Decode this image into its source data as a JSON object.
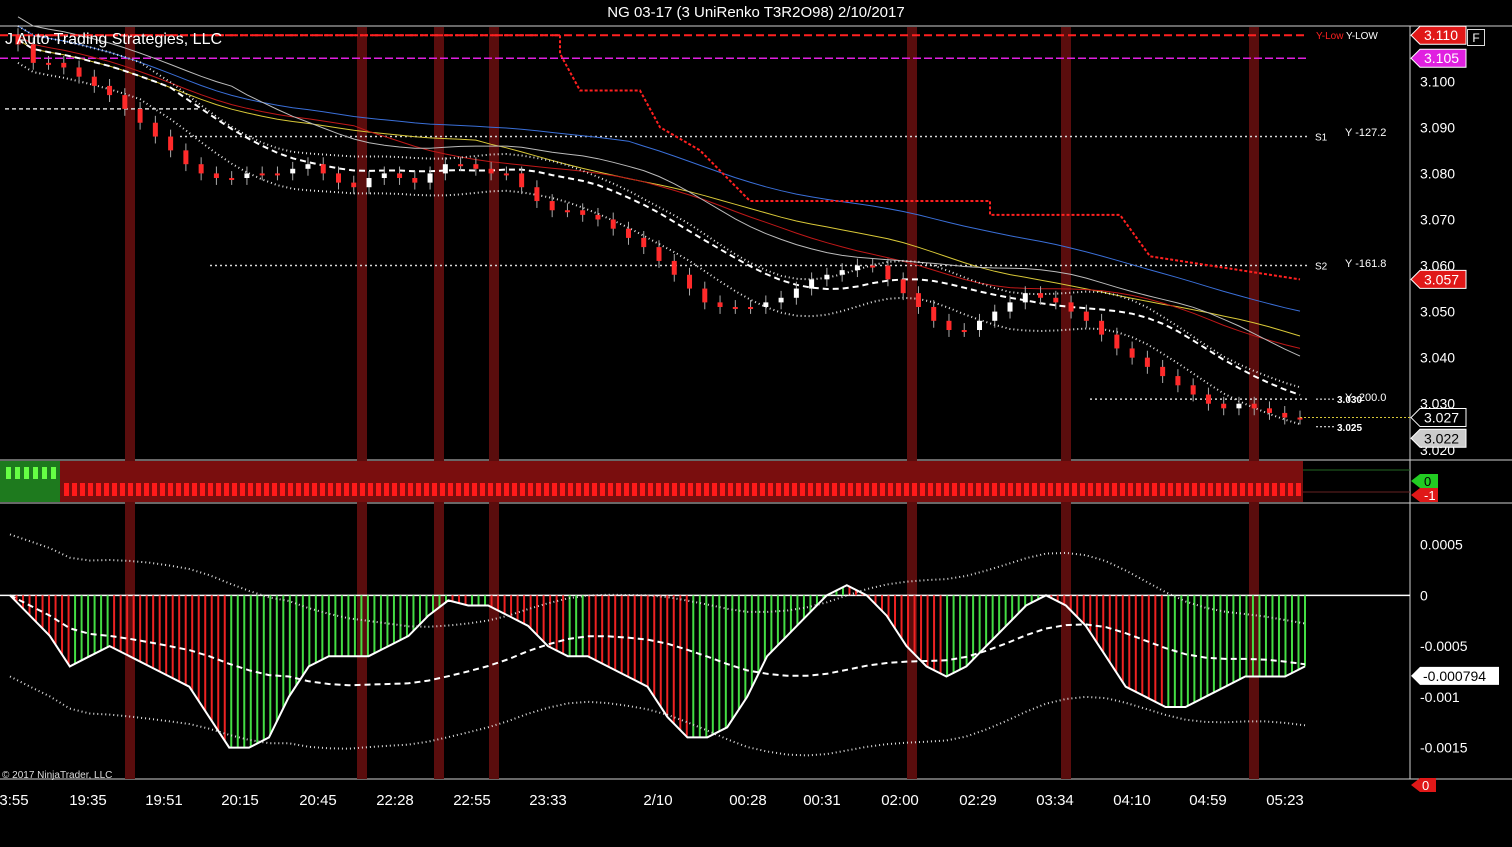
{
  "window": {
    "title": "NG 03-17 (3 UniRenko T3R2O98)  2/10/2017",
    "strategy_label": "J Auto Trading Strategies, LLC",
    "copyright": "© 2017 NinjaTrader, LLC",
    "f_button": "F"
  },
  "colors": {
    "background": "#000000",
    "bear_candle": "#ff2a2a",
    "bull_candle": "#ffffff",
    "session_band": "#5a0d0d",
    "pivot_red": "#ff2020",
    "magenta": "#e020e0",
    "blue_ma": "#3a6fd8",
    "yellow_ma": "#d8c838",
    "hist_green": "#44dd44",
    "hist_red": "#ee2222"
  },
  "chart_data": [
    {
      "type": "candlestick",
      "panel": "price",
      "instrument": "NG 03-17",
      "ylim": [
        3.018,
        3.112
      ],
      "y_ticks": [
        "3.100",
        "3.090",
        "3.080",
        "3.070",
        "3.060",
        "3.050",
        "3.040",
        "3.030",
        "3.020"
      ],
      "price_labels": {
        "y_low": "3.110",
        "magenta_line": "3.105",
        "red_stop": "3.057",
        "last": "3.027",
        "lower": "3.022",
        "target_upper": "3.030",
        "target_lower": "3.025"
      },
      "level_labels": {
        "y_low_left": "Y-Low",
        "y_low_right": "Y-LOW",
        "s1": "S1",
        "s1_value": "Y -127.2",
        "s2": "S2",
        "s2_value": "Y -161.8",
        "y200": "Y -200.0"
      },
      "levels": [
        {
          "name": "Y-Low",
          "value": 3.11
        },
        {
          "name": "Magenta",
          "value": 3.105
        },
        {
          "name": "S1",
          "value": 3.088
        },
        {
          "name": "S2",
          "value": 3.06
        },
        {
          "name": "Y -200.0",
          "value": 3.031
        }
      ],
      "closes": [
        3.108,
        3.104,
        3.104,
        3.103,
        3.101,
        3.099,
        3.097,
        3.094,
        3.091,
        3.088,
        3.085,
        3.082,
        3.08,
        3.079,
        3.079,
        3.08,
        3.08,
        3.08,
        3.081,
        3.082,
        3.08,
        3.078,
        3.077,
        3.079,
        3.08,
        3.079,
        3.078,
        3.08,
        3.082,
        3.082,
        3.081,
        3.08,
        3.08,
        3.077,
        3.074,
        3.072,
        3.072,
        3.071,
        3.07,
        3.068,
        3.066,
        3.064,
        3.061,
        3.058,
        3.055,
        3.052,
        3.051,
        3.051,
        3.051,
        3.052,
        3.053,
        3.055,
        3.057,
        3.058,
        3.059,
        3.06,
        3.06,
        3.057,
        3.054,
        3.051,
        3.048,
        3.046,
        3.046,
        3.048,
        3.05,
        3.052,
        3.054,
        3.053,
        3.052,
        3.05,
        3.048,
        3.045,
        3.042,
        3.04,
        3.038,
        3.036,
        3.034,
        3.032,
        3.03,
        3.029,
        3.03,
        3.029,
        3.028,
        3.027,
        3.027
      ]
    },
    {
      "type": "bar",
      "panel": "trend-strip",
      "axis_labels": [
        "0",
        "-1"
      ]
    },
    {
      "type": "bar",
      "panel": "oscillator",
      "ylim": [
        -0.0018,
        0.0009
      ],
      "y_ticks": [
        "0.0005",
        "0",
        "-0.0005",
        "-0.001",
        "-0.0015"
      ],
      "current_value": "-0.000794",
      "bottom_label": "0",
      "values": [
        0.0,
        -0.0002,
        -0.0004,
        -0.0007,
        -0.0006,
        -0.0005,
        -0.0006,
        -0.0007,
        -0.0008,
        -0.0009,
        -0.0012,
        -0.0015,
        -0.0015,
        -0.0014,
        -0.001,
        -0.0007,
        -0.0006,
        -0.0006,
        -0.0006,
        -0.0005,
        -0.0004,
        -0.0002,
        -5e-05,
        -0.0001,
        -0.0001,
        -0.0002,
        -0.0003,
        -0.0005,
        -0.0006,
        -0.0006,
        -0.0007,
        -0.0008,
        -0.0009,
        -0.0012,
        -0.0014,
        -0.0014,
        -0.0013,
        -0.001,
        -0.0006,
        -0.0004,
        -0.0002,
        0.0,
        0.0001,
        0.0,
        -0.0002,
        -0.0005,
        -0.0007,
        -0.0008,
        -0.0007,
        -0.0005,
        -0.0003,
        -0.0001,
        0.0,
        -0.0001,
        -0.0003,
        -0.0006,
        -0.0009,
        -0.001,
        -0.0011,
        -0.0011,
        -0.001,
        -0.0009,
        -0.0008,
        -0.0008,
        -0.0008,
        -0.0007
      ]
    }
  ],
  "x_axis": {
    "labels": [
      "3:55",
      "19:35",
      "19:51",
      "20:15",
      "20:45",
      "22:28",
      "22:55",
      "23:33",
      "2/10",
      "00:28",
      "00:31",
      "02:00",
      "02:29",
      "03:34",
      "04:10",
      "04:59",
      "05:23"
    ]
  }
}
